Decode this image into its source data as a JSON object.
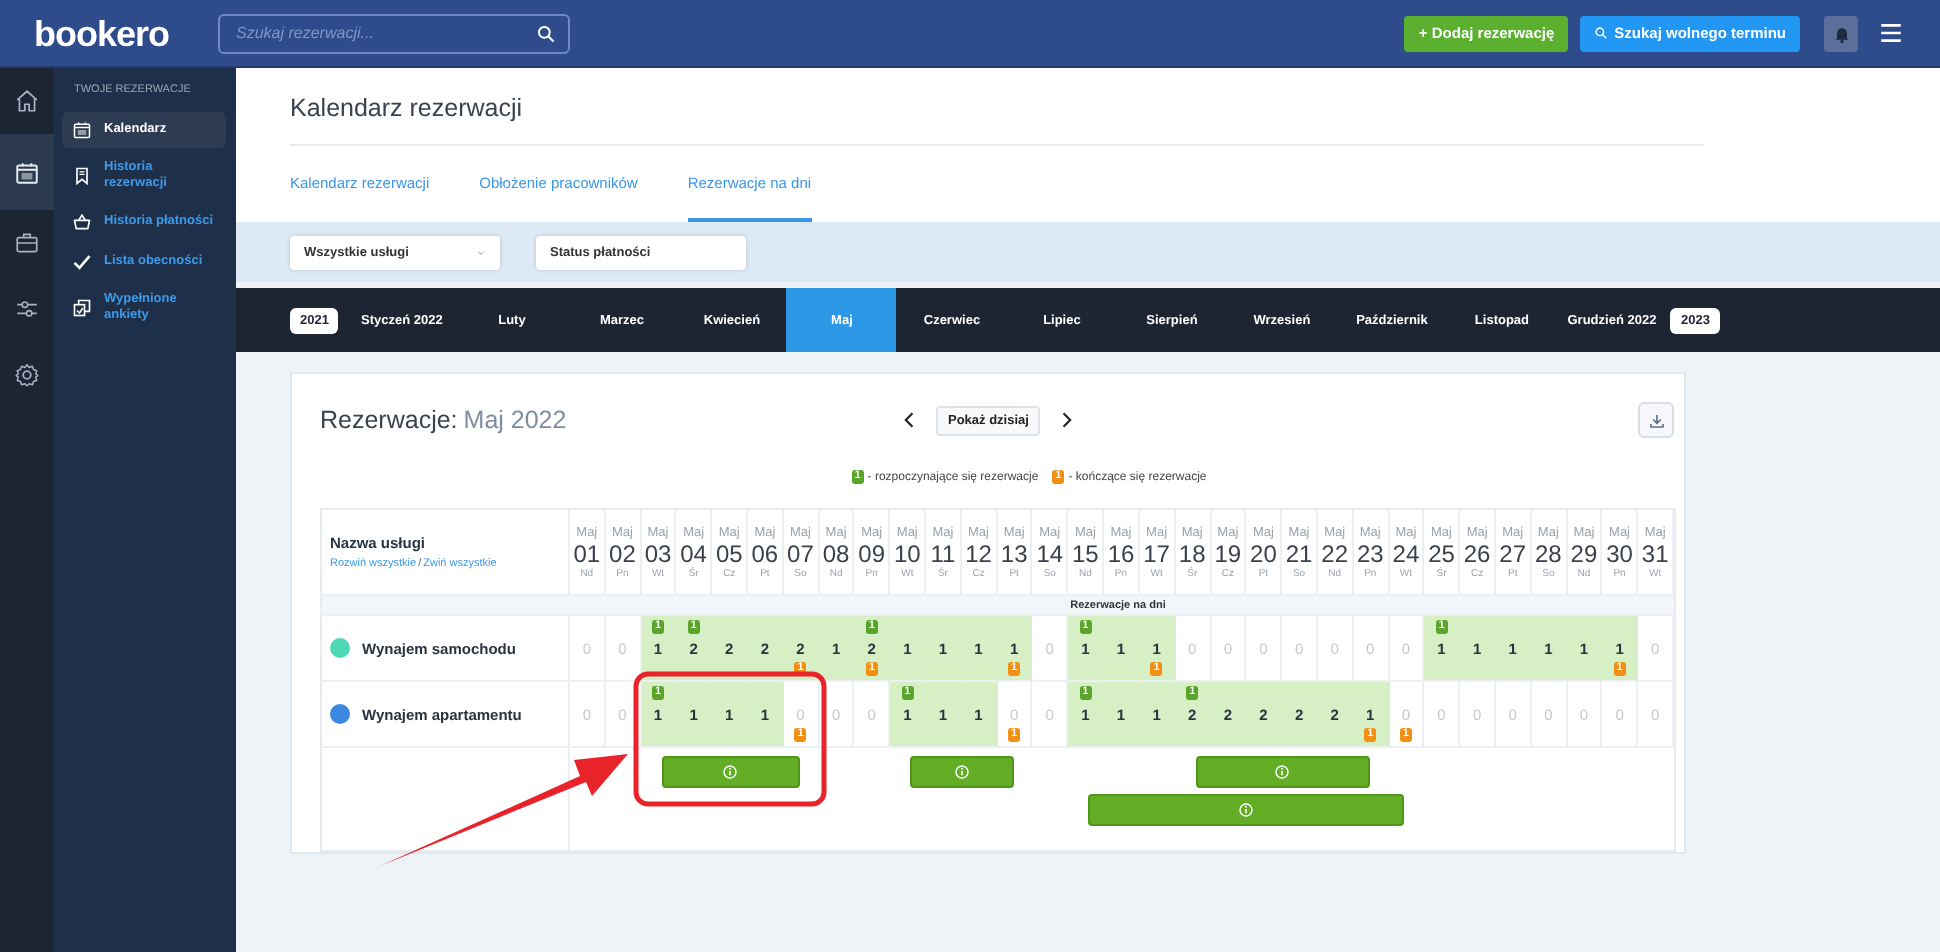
{
  "topbar": {
    "logo": "bookero",
    "search": {
      "placeholder": "Szukaj rezerwacji..."
    },
    "buttons": [
      {
        "kind": "add",
        "label": "+ Dodaj rezerwację"
      },
      {
        "kind": "find",
        "label": "Szukaj wolnego terminu"
      }
    ]
  },
  "rail": [
    {
      "selected": false
    },
    {
      "selected": true
    },
    {
      "selected": false
    },
    {
      "selected": false
    },
    {
      "selected": false
    }
  ],
  "sidebar": {
    "heading": "TWOJE REZERWACJE",
    "items": [
      {
        "label": "Kalendarz",
        "selected": true
      },
      {
        "label": "Historia rezerwacji",
        "selected": false
      },
      {
        "label": "Historia płatności",
        "selected": false
      },
      {
        "label": "Lista obecności",
        "selected": false
      },
      {
        "label": "Wypełnione ankiety",
        "selected": false
      }
    ]
  },
  "page_title": "Kalendarz rezerwacji",
  "tabs": [
    {
      "label": "Kalendarz rezerwacji",
      "selected": false
    },
    {
      "label": "Obłożenie pracowników",
      "selected": false
    },
    {
      "label": "Rezerwacje na dni",
      "selected": true
    }
  ],
  "filters": [
    {
      "label": "Wszystkie usługi",
      "caret": true
    },
    {
      "label": "Status płatności",
      "caret": false
    }
  ],
  "months": [
    {
      "kind": "year",
      "label": "2021",
      "selected": false
    },
    {
      "kind": "month",
      "label": "Styczeń 2022",
      "selected": false
    },
    {
      "kind": "month",
      "label": "Luty",
      "selected": false
    },
    {
      "kind": "month",
      "label": "Marzec",
      "selected": false
    },
    {
      "kind": "month",
      "label": "Kwiecień",
      "selected": false
    },
    {
      "kind": "month",
      "label": "Maj",
      "selected": true
    },
    {
      "kind": "month",
      "label": "Czerwiec",
      "selected": false
    },
    {
      "kind": "month",
      "label": "Lipiec",
      "selected": false
    },
    {
      "kind": "month",
      "label": "Sierpień",
      "selected": false
    },
    {
      "kind": "month",
      "label": "Wrzesień",
      "selected": false
    },
    {
      "kind": "month",
      "label": "Październik",
      "selected": false
    },
    {
      "kind": "month",
      "label": "Listopad",
      "selected": false
    },
    {
      "kind": "month",
      "label": "Grudzień 2022",
      "selected": false
    },
    {
      "kind": "year",
      "label": "2023",
      "selected": false
    }
  ],
  "card": {
    "title": "Rezerwacje:",
    "period": "Maj 2022",
    "today_button": "Pokaż dzisiaj",
    "legend": [
      {
        "kind": "start",
        "badge": "1",
        "text": "- rozpoczynające się rezerwacje"
      },
      {
        "kind": "end",
        "badge": "1",
        "text": "- kończące się rezerwacje"
      }
    ],
    "table": {
      "name_header": "Nazwa usługi",
      "expand_link": "Rozwiń wszystkie",
      "separator": "/",
      "collapse_link": "Zwiń wszystkie",
      "subheader": "Rezerwacje na dni",
      "days": [
        {
          "month": "Maj",
          "day": "01",
          "weekday": "Nd"
        },
        {
          "month": "Maj",
          "day": "02",
          "weekday": "Pn"
        },
        {
          "month": "Maj",
          "day": "03",
          "weekday": "Wt"
        },
        {
          "month": "Maj",
          "day": "04",
          "weekday": "Śr"
        },
        {
          "month": "Maj",
          "day": "05",
          "weekday": "Cz"
        },
        {
          "month": "Maj",
          "day": "06",
          "weekday": "Pt"
        },
        {
          "month": "Maj",
          "day": "07",
          "weekday": "So"
        },
        {
          "month": "Maj",
          "day": "08",
          "weekday": "Nd"
        },
        {
          "month": "Maj",
          "day": "09",
          "weekday": "Pn"
        },
        {
          "month": "Maj",
          "day": "10",
          "weekday": "Wt"
        },
        {
          "month": "Maj",
          "day": "11",
          "weekday": "Śr"
        },
        {
          "month": "Maj",
          "day": "12",
          "weekday": "Cz"
        },
        {
          "month": "Maj",
          "day": "13",
          "weekday": "Pt"
        },
        {
          "month": "Maj",
          "day": "14",
          "weekday": "So"
        },
        {
          "month": "Maj",
          "day": "15",
          "weekday": "Nd"
        },
        {
          "month": "Maj",
          "day": "16",
          "weekday": "Pn"
        },
        {
          "month": "Maj",
          "day": "17",
          "weekday": "Wt"
        },
        {
          "month": "Maj",
          "day": "18",
          "weekday": "Śr"
        },
        {
          "month": "Maj",
          "day": "19",
          "weekday": "Cz"
        },
        {
          "month": "Maj",
          "day": "20",
          "weekday": "Pt"
        },
        {
          "month": "Maj",
          "day": "21",
          "weekday": "So"
        },
        {
          "month": "Maj",
          "day": "22",
          "weekday": "Nd"
        },
        {
          "month": "Maj",
          "day": "23",
          "weekday": "Pn"
        },
        {
          "month": "Maj",
          "day": "24",
          "weekday": "Wt"
        },
        {
          "month": "Maj",
          "day": "25",
          "weekday": "Śr"
        },
        {
          "month": "Maj",
          "day": "26",
          "weekday": "Cz"
        },
        {
          "month": "Maj",
          "day": "27",
          "weekday": "Pt"
        },
        {
          "month": "Maj",
          "day": "28",
          "weekday": "So"
        },
        {
          "month": "Maj",
          "day": "29",
          "weekday": "Nd"
        },
        {
          "month": "Maj",
          "day": "30",
          "weekday": "Pn"
        },
        {
          "month": "Maj",
          "day": "31",
          "weekday": "Wt"
        }
      ],
      "services": [
        {
          "name": "Wynajem samochodu",
          "color": "#4fd8b6",
          "cells": [
            {
              "value": "0",
              "booked": false
            },
            {
              "value": "0",
              "booked": false
            },
            {
              "value": "1",
              "booked": true,
              "start": "1"
            },
            {
              "value": "2",
              "booked": true,
              "start": "1"
            },
            {
              "value": "2",
              "booked": true
            },
            {
              "value": "2",
              "booked": true
            },
            {
              "value": "2",
              "booked": true,
              "end": "1"
            },
            {
              "value": "1",
              "booked": true
            },
            {
              "value": "2",
              "booked": true,
              "start": "1",
              "end": "1"
            },
            {
              "value": "1",
              "booked": true
            },
            {
              "value": "1",
              "booked": true
            },
            {
              "value": "1",
              "booked": true
            },
            {
              "value": "1",
              "booked": true,
              "end": "1"
            },
            {
              "value": "0",
              "booked": false
            },
            {
              "value": "1",
              "booked": true,
              "start": "1"
            },
            {
              "value": "1",
              "booked": true
            },
            {
              "value": "1",
              "booked": true,
              "end": "1"
            },
            {
              "value": "0",
              "booked": false
            },
            {
              "value": "0",
              "booked": false
            },
            {
              "value": "0",
              "booked": false
            },
            {
              "value": "0",
              "booked": false
            },
            {
              "value": "0",
              "booked": false
            },
            {
              "value": "0",
              "booked": false
            },
            {
              "value": "0",
              "booked": false
            },
            {
              "value": "1",
              "booked": true,
              "start": "1"
            },
            {
              "value": "1",
              "booked": true
            },
            {
              "value": "1",
              "booked": true
            },
            {
              "value": "1",
              "booked": true
            },
            {
              "value": "1",
              "booked": true
            },
            {
              "value": "1",
              "booked": true,
              "end": "1"
            },
            {
              "value": "0",
              "booked": false
            }
          ],
          "expanded": false
        },
        {
          "name": "Wynajem apartamentu",
          "color": "#3c87e0",
          "cells": [
            {
              "value": "0",
              "booked": false
            },
            {
              "value": "0",
              "booked": false
            },
            {
              "value": "1",
              "booked": true,
              "start": "1"
            },
            {
              "value": "1",
              "booked": true
            },
            {
              "value": "1",
              "booked": true
            },
            {
              "value": "1",
              "booked": true
            },
            {
              "value": "0",
              "booked": false,
              "end": "1"
            },
            {
              "value": "0",
              "booked": false
            },
            {
              "value": "0",
              "booked": false
            },
            {
              "value": "1",
              "booked": true,
              "start": "1"
            },
            {
              "value": "1",
              "booked": true
            },
            {
              "value": "1",
              "booked": true
            },
            {
              "value": "0",
              "booked": false,
              "end": "1"
            },
            {
              "value": "0",
              "booked": false
            },
            {
              "value": "1",
              "booked": true,
              "start": "1"
            },
            {
              "value": "1",
              "booked": true
            },
            {
              "value": "1",
              "booked": true
            },
            {
              "value": "2",
              "booked": true,
              "start": "1"
            },
            {
              "value": "2",
              "booked": true
            },
            {
              "value": "2",
              "booked": true
            },
            {
              "value": "2",
              "booked": true
            },
            {
              "value": "2",
              "booked": true
            },
            {
              "value": "1",
              "booked": true,
              "end": "1"
            },
            {
              "value": "0",
              "booked": false,
              "end": "1"
            },
            {
              "value": "0",
              "booked": false
            },
            {
              "value": "0",
              "booked": false
            },
            {
              "value": "0",
              "booked": false
            },
            {
              "value": "0",
              "booked": false
            },
            {
              "value": "0",
              "booked": false
            },
            {
              "value": "0",
              "booked": false
            },
            {
              "value": "0",
              "booked": false
            }
          ],
          "expanded": true
        }
      ]
    }
  },
  "annotation": {
    "frame": true,
    "arrow": true
  }
}
